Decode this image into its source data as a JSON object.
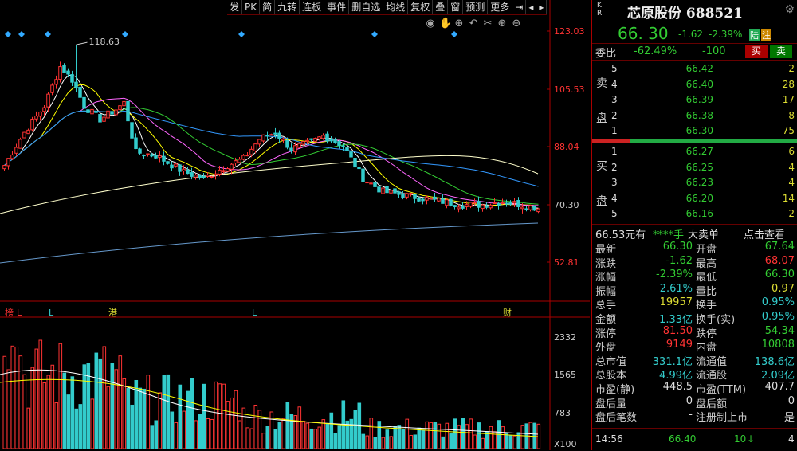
{
  "toolbar": {
    "items": [
      "发",
      "PK",
      "简",
      "九转",
      "连板",
      "事件",
      "删自选",
      "均线",
      "复权",
      "叠",
      "窗",
      "预测",
      "更多"
    ]
  },
  "chart_icons": [
    "eye-icon",
    "hand-icon",
    "zoom-in-icon",
    "undo-icon",
    "cut-icon",
    "plus-icon",
    "minus-icon"
  ],
  "chart_data": {
    "type": "candlestick",
    "price_axis_ticks": [
      "123.03",
      "105.53",
      "88.04",
      "70.30",
      "52.81"
    ],
    "price_axis_values": [
      123.03,
      105.53,
      88.04,
      70.3,
      52.81
    ],
    "high_annotation": "118.63",
    "volume_axis_ticks": [
      "2332",
      "1565",
      "783",
      "X100"
    ],
    "volume_axis_values": [
      2332,
      1565,
      783
    ],
    "event_markers": [
      {
        "text": "榜",
        "x_index": 1,
        "color": "#f33"
      },
      {
        "text": "L",
        "x_index": 4,
        "color": "#f33"
      },
      {
        "text": "L",
        "x_index": 12,
        "color": "#3cc"
      },
      {
        "text": "港",
        "x_index": 27,
        "color": "#dd3"
      },
      {
        "text": "L",
        "x_index": 63,
        "color": "#3cc"
      },
      {
        "text": "财",
        "x_index": 126,
        "color": "#dd3"
      }
    ]
  },
  "stock": {
    "kr": "K\nR",
    "name": "芯原股份",
    "code": "688521",
    "price": "66. 30",
    "change": "-1.62",
    "change_pct": "-2.39%",
    "tag1": "陆",
    "tag2": "注"
  },
  "weibi": {
    "label": "委比",
    "ratio": "-62.49%",
    "diff": "-100",
    "buy": "买",
    "sell": "卖"
  },
  "sell_side_label": "卖\n\n盘",
  "buy_side_label": "买\n\n盘",
  "asks": [
    {
      "level": "5",
      "price": "66.42",
      "qty": "2"
    },
    {
      "level": "4",
      "price": "66.40",
      "qty": "28"
    },
    {
      "level": "3",
      "price": "66.39",
      "qty": "17"
    },
    {
      "level": "2",
      "price": "66.38",
      "qty": "8"
    },
    {
      "level": "1",
      "price": "66.30",
      "qty": "75"
    }
  ],
  "bids": [
    {
      "level": "1",
      "price": "66.27",
      "qty": "6"
    },
    {
      "level": "2",
      "price": "66.25",
      "qty": "4"
    },
    {
      "level": "3",
      "price": "66.23",
      "qty": "4"
    },
    {
      "level": "4",
      "price": "66.20",
      "qty": "14"
    },
    {
      "level": "5",
      "price": "66.16",
      "qty": "2"
    }
  ],
  "bigorder": {
    "price": "66.53元有",
    "hand": "****手",
    "label": "大卖单",
    "link": "点击查看"
  },
  "stats": [
    {
      "k": "最新",
      "v": "66.30",
      "c": "green",
      "k2": "开盘",
      "v2": "67.64",
      "c2": "green"
    },
    {
      "k": "涨跌",
      "v": "-1.62",
      "c": "green",
      "k2": "最高",
      "v2": "68.07",
      "c2": "red"
    },
    {
      "k": "涨幅",
      "v": "-2.39%",
      "c": "green",
      "k2": "最低",
      "v2": "66.30",
      "c2": "green"
    },
    {
      "k": "振幅",
      "v": "2.61%",
      "c": "cyan",
      "k2": "量比",
      "v2": "0.97",
      "c2": "yellow"
    },
    {
      "k": "总手",
      "v": "19957",
      "c": "yellow",
      "k2": "换手",
      "v2": "0.95%",
      "c2": "cyan"
    },
    {
      "k": "金额",
      "v": "1.33亿",
      "c": "cyan",
      "k2": "换手(实)",
      "v2": "0.95%",
      "c2": "cyan"
    },
    {
      "k": "涨停",
      "v": "81.50",
      "c": "red",
      "k2": "跌停",
      "v2": "54.34",
      "c2": "green"
    },
    {
      "k": "外盘",
      "v": "9149",
      "c": "red",
      "k2": "内盘",
      "v2": "10808",
      "c2": "green"
    },
    {
      "k": "总市值",
      "v": "331.1亿",
      "c": "cyan",
      "k2": "流通值",
      "v2": "138.6亿",
      "c2": "cyan"
    },
    {
      "k": "总股本",
      "v": "4.99亿",
      "c": "cyan",
      "k2": "流通股",
      "v2": "2.09亿",
      "c2": "cyan"
    },
    {
      "k": "市盈(静)",
      "v": "448.5",
      "c": "white",
      "k2": "市盈(TTM)",
      "v2": "407.7",
      "c2": "white"
    },
    {
      "k": "盘后量",
      "v": "0",
      "c": "white",
      "k2": "盘后额",
      "v2": "0",
      "c2": "white"
    },
    {
      "k": "盘后笔数",
      "v": "-",
      "c": "white",
      "k2": "注册制上市",
      "v2": "是",
      "c2": "white"
    }
  ],
  "tick": {
    "time": "14:56",
    "price": "66.40",
    "vol": "10",
    "dir": "↓",
    "count": "4"
  },
  "colors": {
    "up": "#ff3333",
    "down": "#33cccc",
    "ma5": "#ffffff",
    "ma10": "#ffff00",
    "ma20": "#ff66ff",
    "ma30": "#33cc33",
    "ma60": "#3399ff",
    "ma120": "#ffffcc",
    "ma250": "#6699cc"
  }
}
